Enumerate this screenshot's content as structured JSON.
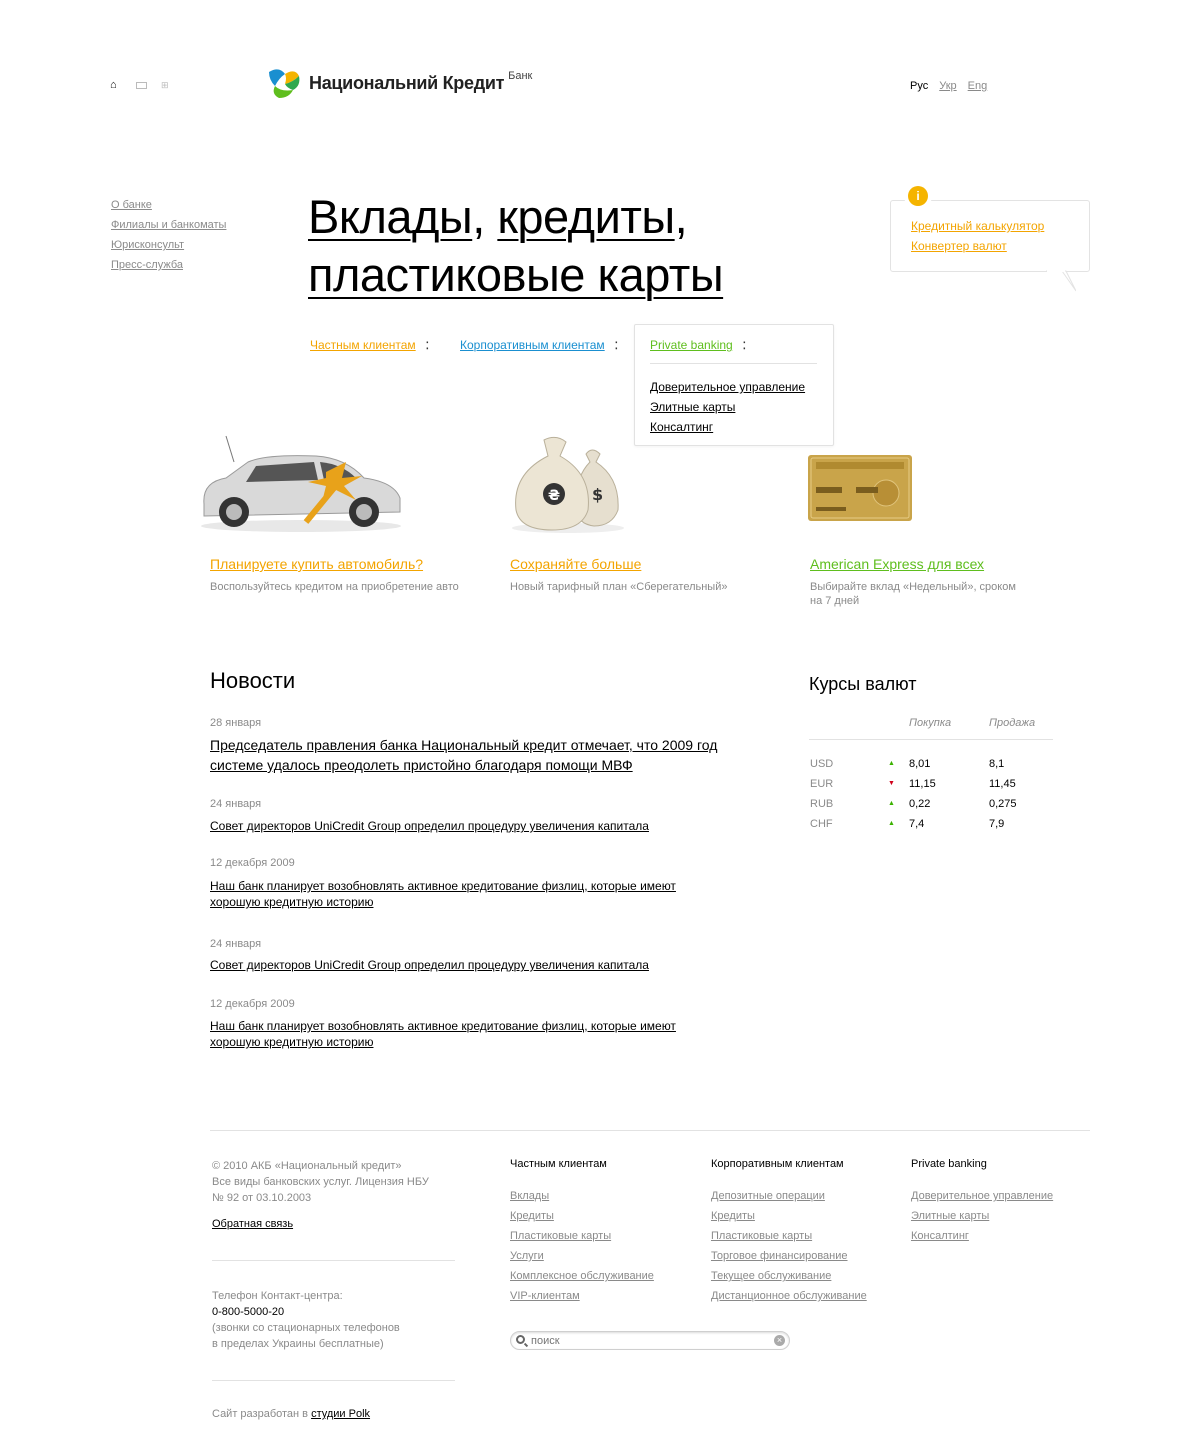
{
  "header": {
    "icons": [
      "home-icon",
      "mail-icon",
      "sitemap-icon"
    ],
    "logo_text": "Национальний Кредит",
    "logo_sub": "Банк",
    "langs": [
      "Рус",
      "Укр",
      "Eng"
    ]
  },
  "left_menu": [
    "О банке",
    "Филиалы и банкоматы",
    "Юрисконсульт",
    "Пресс-служба"
  ],
  "hero": {
    "part1": "Вклады",
    "sep1": ", ",
    "part2": "кредиты",
    "sep2": ",",
    "part3": "пластиковые карты"
  },
  "info_box": {
    "icon": "info-icon",
    "links": [
      "Кредитный калькулятор",
      "Конвертер валют"
    ]
  },
  "nav": {
    "tabs": [
      {
        "label": "Частным клиентам",
        "color": "#f3a400"
      },
      {
        "label": "Корпоративным клиентам",
        "color": "#1a8fd0"
      },
      {
        "label": "Private banking",
        "color": "#5fbe1e"
      }
    ],
    "private_items": [
      "Доверительное управление",
      "Элитные карты",
      "Консалтинг"
    ]
  },
  "promos": [
    {
      "title": "Планируете купить автомобиль?",
      "desc": "Воспользуйтесь кредитом на приобретение авто",
      "color": "#f3a400"
    },
    {
      "title": "Сохраняйте больше",
      "desc": "Новый тарифный план «Сберегательный»",
      "color": "#f3a400"
    },
    {
      "title": "American Express для всех",
      "desc": "Выбирайте вклад «Недельный», сроком на 7 дней",
      "color": "#5fbe1e"
    }
  ],
  "news": {
    "title": "Новости",
    "items": [
      {
        "date": "28 января",
        "text": "Председатель правления банка Национальный кредит отмечает, что 2009 год системе удалось преодолеть пристойно благодаря помощи МВФ"
      },
      {
        "date": "24 января",
        "text": "Совет директоров UniCredit Group определил процедуру увеличения капитала"
      },
      {
        "date": "12 декабря 2009",
        "text": "Наш банк планирует возобновлять активное кредитование физлиц, которые имеют хорошую кредитную историю"
      },
      {
        "date": "24 января",
        "text": "Совет директоров UniCredit Group определил процедуру увеличения капитала"
      },
      {
        "date": "12 декабря 2009",
        "text": "Наш банк планирует возобновлять активное кредитование физлиц, которые имеют хорошую кредитную историю"
      }
    ]
  },
  "currency": {
    "title": "Курсы валют",
    "head_buy": "Покупка",
    "head_sell": "Продажа",
    "rows": [
      {
        "code": "USD",
        "trend": "up",
        "buy": "8,01",
        "sell": "8,1"
      },
      {
        "code": "EUR",
        "trend": "down",
        "buy": "11,15",
        "sell": "11,45"
      },
      {
        "code": "RUB",
        "trend": "up",
        "buy": "0,22",
        "sell": "0,275"
      },
      {
        "code": "CHF",
        "trend": "up",
        "buy": "7,4",
        "sell": "7,9"
      }
    ],
    "up_color": "#3cb200",
    "down_color": "#d0021b"
  },
  "footer": {
    "copy1": "© 2010 АКБ «Национальный кредит»",
    "copy2": "Все виды банковских услуг. Лицензия НБУ",
    "copy3": "№ 92 от 03.10.2003",
    "feedback": "Обратная связь",
    "phone_label": "Телефон Контакт-центра:",
    "phone": "0-800-5000-20",
    "phone_note1": "(звонки со стационарных телефонов",
    "phone_note2": "в пределах Украины бесплатные)",
    "credits_prefix": "Сайт разработан в ",
    "credits_link": "студии Polk",
    "columns": [
      {
        "title": "Частным клиентам",
        "items": [
          "Вклады",
          "Кредиты",
          "Пластиковые карты",
          "Услуги",
          "Комплексное обслуживание",
          "VIP-клиентам"
        ]
      },
      {
        "title": "Корпоративным клиентам",
        "items": [
          "Депозитные операции",
          "Кредиты",
          "Пластиковые карты",
          "Торговое финансирование",
          "Текущее обслуживание",
          "Дистанционное обслуживание"
        ]
      },
      {
        "title": "Private banking",
        "items": [
          "Доверительное управление",
          "Элитные карты",
          "Консалтинг"
        ]
      }
    ],
    "search_placeholder": "поиск"
  }
}
